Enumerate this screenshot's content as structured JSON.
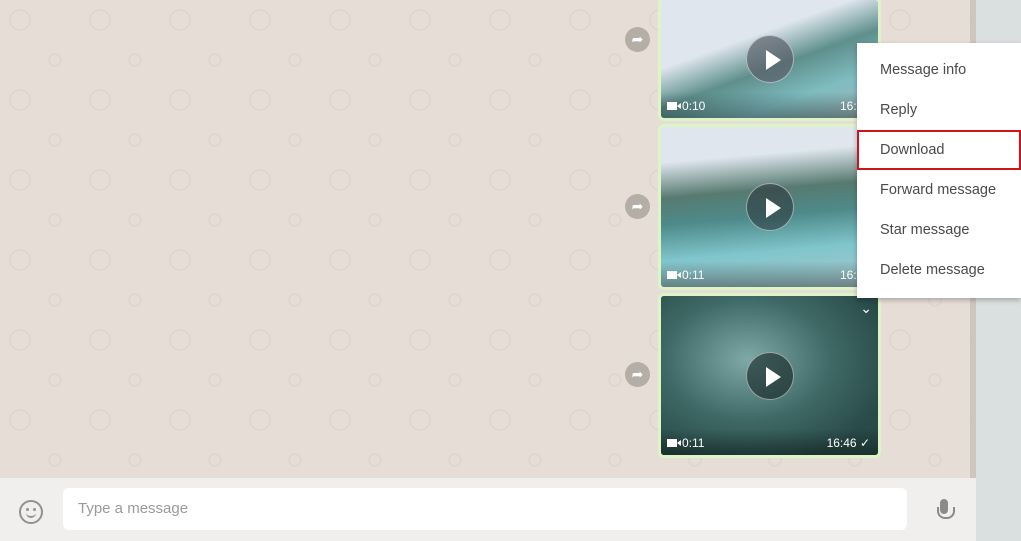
{
  "messages": [
    {
      "duration": "0:10",
      "time": "16:44",
      "status": ""
    },
    {
      "duration": "0:11",
      "time": "16:45",
      "status": ""
    },
    {
      "duration": "0:11",
      "time": "16:46",
      "status": "✓"
    }
  ],
  "context_menu": {
    "items": [
      "Message info",
      "Reply",
      "Download",
      "Forward message",
      "Star message",
      "Delete message"
    ],
    "highlighted": "Download"
  },
  "composer": {
    "placeholder": "Type a message"
  },
  "colors": {
    "highlight": "#d0121b",
    "bubble_border": "#dcf4c6",
    "chat_bg": "#e6ded6"
  }
}
